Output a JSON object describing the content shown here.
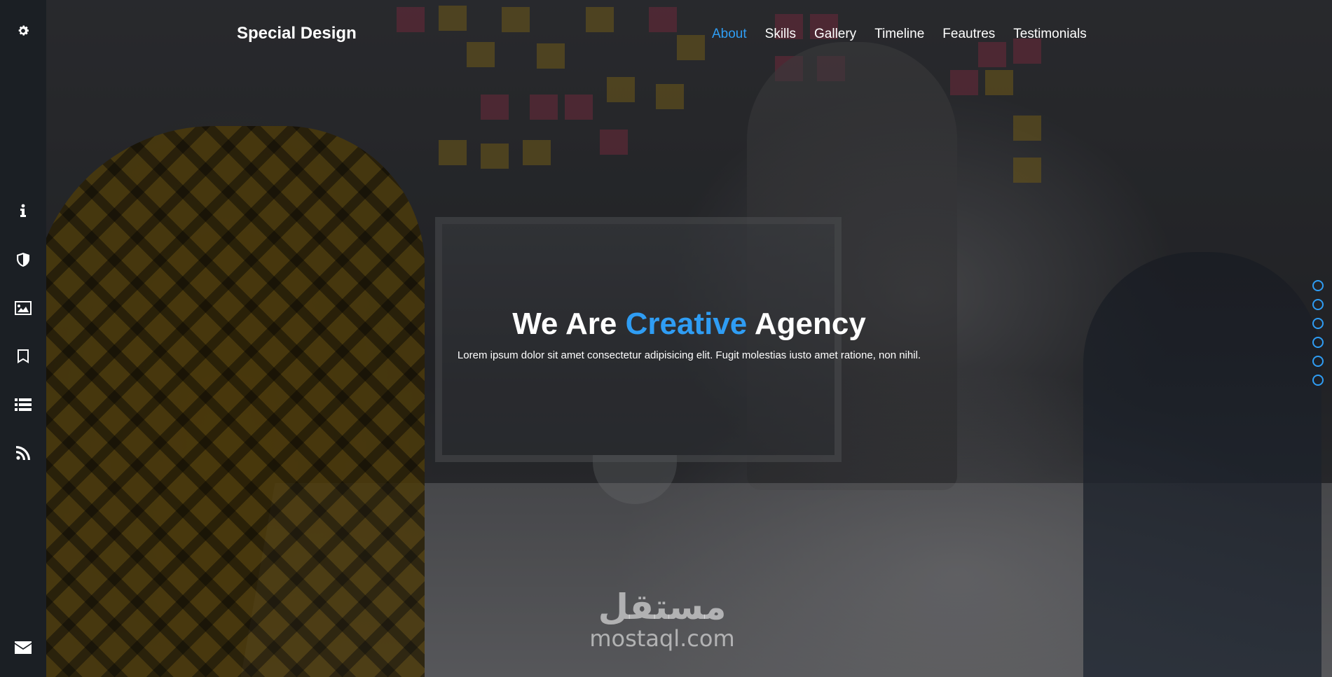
{
  "brand": "Special Design",
  "nav": {
    "items": [
      {
        "label": "About",
        "active": true
      },
      {
        "label": "Skills",
        "active": false
      },
      {
        "label": "Gallery",
        "active": false
      },
      {
        "label": "Timeline",
        "active": false
      },
      {
        "label": "Feautres",
        "active": false
      },
      {
        "label": "Testimonials",
        "active": false
      }
    ]
  },
  "hero": {
    "title_before": "We Are ",
    "title_accent": "Creative",
    "title_after": " Agency",
    "subtitle": "Lorem ipsum dolor sit amet consectetur adipisicing elit. Fugit molestias iusto amet ratione, non nihil."
  },
  "sidebar": {
    "icons": [
      "gear-icon",
      "info-icon",
      "shield-icon",
      "image-icon",
      "bookmark-icon",
      "list-icon",
      "rss-icon",
      "envelope-icon"
    ]
  },
  "bullets": {
    "count": 6
  },
  "watermark": {
    "arabic": "مستقل",
    "latin": "mostaql.com"
  },
  "colors": {
    "accent": "#2f9df4",
    "sidebar": "#1b1f24",
    "text": "#ffffff"
  }
}
